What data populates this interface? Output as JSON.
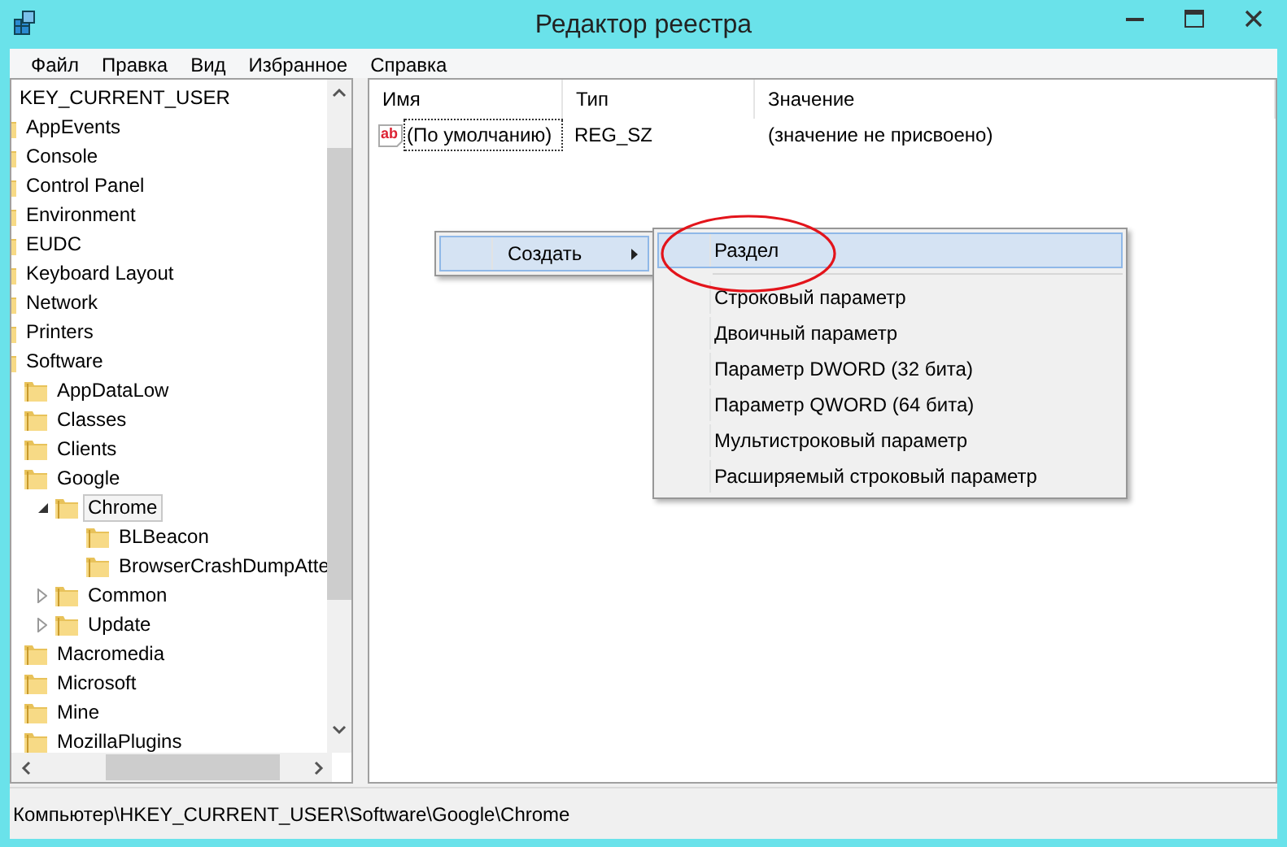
{
  "window": {
    "title": "Редактор реестра"
  },
  "menu_bar": [
    "Файл",
    "Правка",
    "Вид",
    "Избранное",
    "Справка"
  ],
  "tree": {
    "label": "KEY_CURRENT_USER",
    "selected": false,
    "children": [
      {
        "label": "AppEvents",
        "selected": false
      },
      {
        "label": "Console",
        "selected": false
      },
      {
        "label": "Control Panel",
        "selected": false
      },
      {
        "label": "Environment",
        "selected": false
      },
      {
        "label": "EUDC",
        "selected": false
      },
      {
        "label": "Keyboard Layout",
        "selected": false
      },
      {
        "label": "Network",
        "selected": false
      },
      {
        "label": "Printers",
        "selected": false
      },
      {
        "label": "Software",
        "selected": false,
        "children": [
          {
            "label": "AppDataLow",
            "selected": false
          },
          {
            "label": "Classes",
            "selected": false
          },
          {
            "label": "Clients",
            "selected": false
          },
          {
            "label": "Google",
            "selected": false,
            "children": [
              {
                "label": "Chrome",
                "selected": true,
                "expanded": true,
                "children": [
                  {
                    "label": "BLBeacon",
                    "selected": false
                  },
                  {
                    "label": "BrowserCrashDumpAtte",
                    "selected": false
                  }
                ]
              },
              {
                "label": "Common",
                "selected": false,
                "expanded": false
              },
              {
                "label": "Update",
                "selected": false,
                "expanded": false
              }
            ]
          },
          {
            "label": "Macromedia",
            "selected": false
          },
          {
            "label": "Microsoft",
            "selected": false
          },
          {
            "label": "Mine",
            "selected": false
          },
          {
            "label": "MozillaPlugins",
            "selected": false
          }
        ]
      }
    ]
  },
  "values_table": {
    "columns": [
      "Имя",
      "Тип",
      "Значение"
    ],
    "rows": [
      {
        "icon_text": "ab",
        "name": "(По умолчанию)",
        "type": "REG_SZ",
        "data": "(значение не присвоено)",
        "focused": true
      }
    ]
  },
  "context_menu": {
    "items": [
      {
        "label": "Создать",
        "selected": true,
        "has_submenu": true
      }
    ]
  },
  "submenu": {
    "items": [
      {
        "kind": "item",
        "label": "Раздел",
        "selected": true
      },
      {
        "kind": "separator"
      },
      {
        "kind": "item",
        "label": "Строковый параметр",
        "selected": false
      },
      {
        "kind": "item",
        "label": "Двоичный параметр",
        "selected": false
      },
      {
        "kind": "item",
        "label": "Параметр DWORD (32 бита)",
        "selected": false
      },
      {
        "kind": "item",
        "label": "Параметр QWORD (64 бита)",
        "selected": false
      },
      {
        "kind": "item",
        "label": "Мультистроковый параметр",
        "selected": false
      },
      {
        "kind": "item",
        "label": "Расширяемый строковый параметр",
        "selected": false
      }
    ]
  },
  "status_bar": "Компьютер\\HKEY_CURRENT_USER\\Software\\Google\\Chrome"
}
